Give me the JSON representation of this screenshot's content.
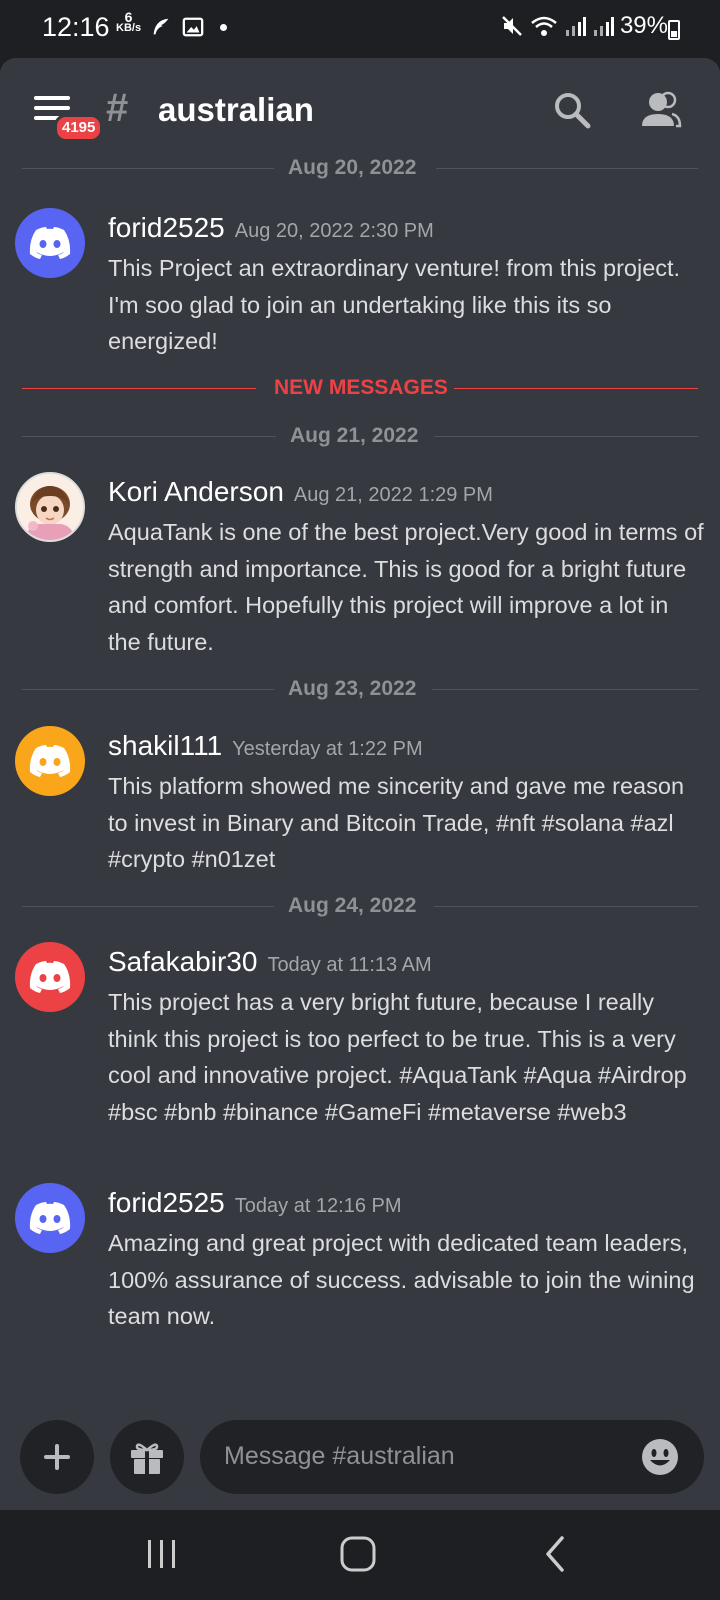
{
  "status": {
    "time": "12:16",
    "net_speed_num": "6",
    "net_speed_unit": "KB/s",
    "battery": "39%"
  },
  "header": {
    "channel": "australian",
    "badge_count": "4195"
  },
  "dividers": {
    "d1": "Aug 20, 2022",
    "new": "NEW MESSAGES",
    "d2": "Aug 21, 2022",
    "d3": "Aug 23, 2022",
    "d4": "Aug 24, 2022"
  },
  "messages": [
    {
      "author": "forid2525",
      "timestamp": "Aug 20, 2022 2:30 PM",
      "text": "This Project an extraordinary venture!  from this project. I'm soo glad to join an undertaking like this its so energized!",
      "avatar_color": "#5865f2"
    },
    {
      "author": "Kori Anderson",
      "timestamp": "Aug 21, 2022 1:29 PM",
      "text": "AquaTank is one of the best project.Very good in terms of strength and importance. This is good for a bright future and  comfort. Hopefully this project will improve a lot in the future.",
      "avatar_color": "#f5e6d8"
    },
    {
      "author": "shakil111",
      "timestamp": "Yesterday at 1:22 PM",
      "text": "This platform showed me sincerity and gave me reason to invest in Binary and Bitcoin Trade, #nft #solana #azl #crypto #n01zet",
      "avatar_color": "#faa61a"
    },
    {
      "author": "Safakabir30",
      "timestamp": "Today at 11:13 AM",
      "text": "This project has a very bright future, because I really think this project is too perfect to be true. This is a very cool and innovative project. #AquaTank #Aqua #Airdrop #bsc #bnb #binance #GameFi #metaverse #web3",
      "avatar_color": "#ed4245"
    },
    {
      "author": "forid2525",
      "timestamp": "Today at 12:16 PM",
      "text": "Amazing and great project with dedicated team leaders, 100% assurance of success. advisable to join the wining team now.",
      "avatar_color": "#5865f2"
    }
  ],
  "composer": {
    "placeholder": "Message #australian"
  },
  "icons": {
    "menu": "hamburger-menu-icon",
    "search": "search-icon",
    "members": "members-icon",
    "add": "plus-icon",
    "gift": "gift-icon",
    "emoji": "emoji-icon"
  }
}
